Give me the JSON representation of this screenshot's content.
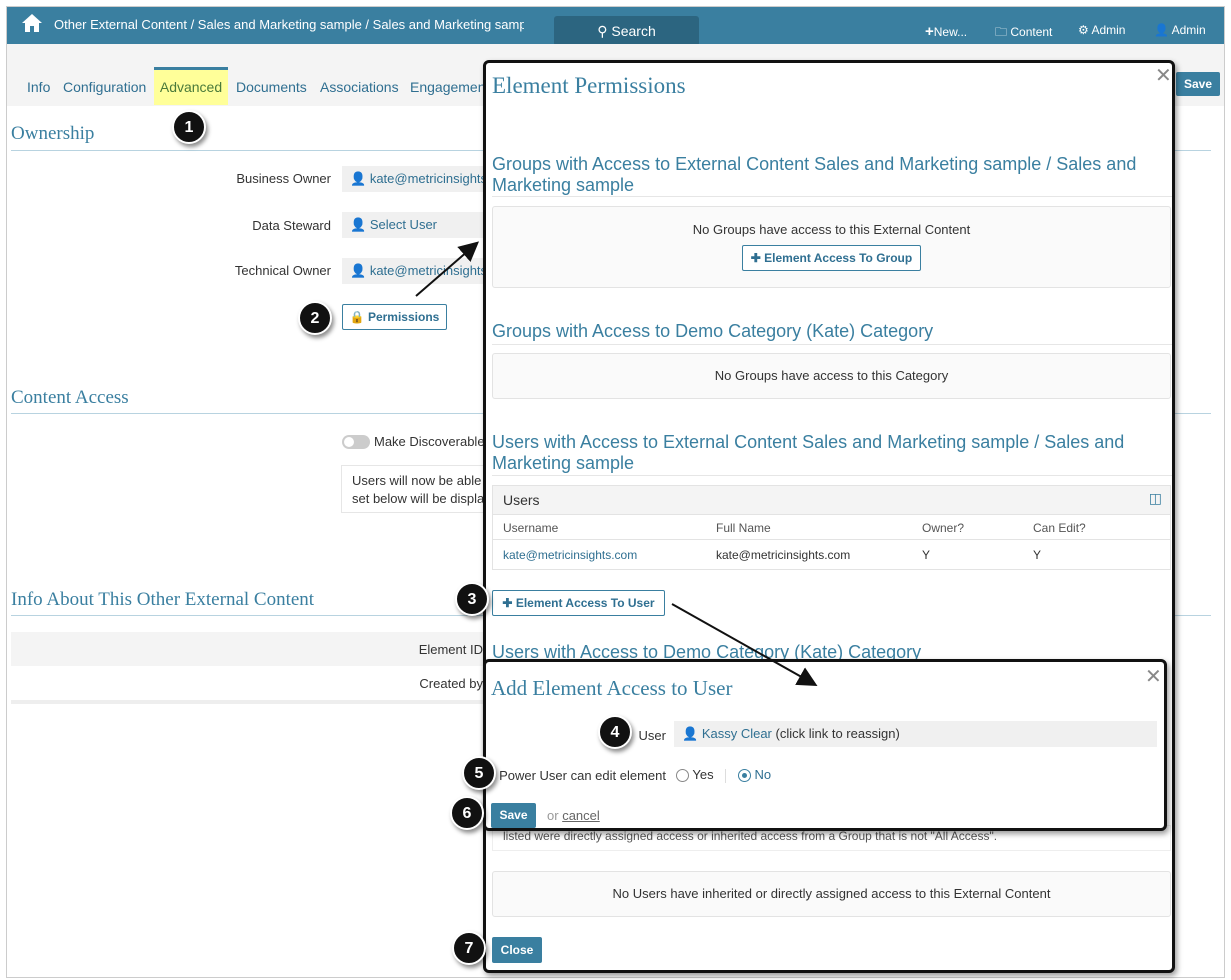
{
  "topbar": {
    "breadcrumb": "Other External Content / Sales and Marketing sample / Sales and Marketing sample",
    "search_label": "Search",
    "new_label": "New...",
    "content_label": "Content",
    "admin_label": "Admin",
    "user_label": "Admin"
  },
  "tabs": [
    "Info",
    "Configuration",
    "Advanced",
    "Documents",
    "Associations",
    "Engagement"
  ],
  "active_tab": "Advanced",
  "save_label": "Save",
  "ownership": {
    "title": "Ownership",
    "business_owner_label": "Business Owner",
    "business_owner": "kate@metricinsights.com",
    "data_steward_label": "Data Steward",
    "data_steward": "Select User",
    "technical_owner_label": "Technical Owner",
    "technical_owner": "kate@metricinsights.com",
    "permissions_label": "Permissions"
  },
  "content_access": {
    "title": "Content Access",
    "discoverable_label": "Make Discoverable",
    "discoverable_on": false,
    "note_line1": "Users will now be able",
    "note_line2": "set below will be displa"
  },
  "info": {
    "title": "Info About This Other External Content",
    "element_id_label": "Element ID",
    "created_by_label": "Created by"
  },
  "modal": {
    "title": "Element Permissions",
    "groups_ext_title": "Groups with Access to External Content Sales and Marketing sample / Sales and Marketing sample",
    "groups_ext_empty": "No Groups have access to this External Content",
    "add_group_label": "Element Access To Group",
    "groups_cat_title": "Groups with Access to Demo Category (Kate) Category",
    "groups_cat_empty": "No Groups have access to this Category",
    "users_ext_title": "Users with Access to External Content Sales and Marketing sample / Sales and Marketing sample",
    "users_table": {
      "title": "Users",
      "columns": [
        "Username",
        "Full Name",
        "Owner?",
        "Can Edit?"
      ],
      "rows": [
        [
          "kate@metricinsights.com",
          "kate@metricinsights.com",
          "Y",
          "Y"
        ]
      ]
    },
    "add_user_label": "Element Access To User",
    "users_cat_title": "Users with Access to Demo Category (Kate) Category",
    "inherited_note": "listed were directly assigned access or inherited access from a Group that is not \"All Access\".",
    "users_inherited_empty": "No Users have inherited or directly assigned access to this External Content",
    "close_label": "Close"
  },
  "popup": {
    "title": "Add Element Access to User",
    "user_label": "User",
    "user_value": "Kassy Clear",
    "user_hint": "(click link to reassign)",
    "power_user_label": "Power User can edit element",
    "yes_label": "Yes",
    "no_label": "No",
    "selected": "No",
    "save_label": "Save",
    "or_label": "or",
    "cancel_label": "cancel"
  },
  "callouts": [
    "1",
    "2",
    "3",
    "4",
    "5",
    "6",
    "7"
  ]
}
